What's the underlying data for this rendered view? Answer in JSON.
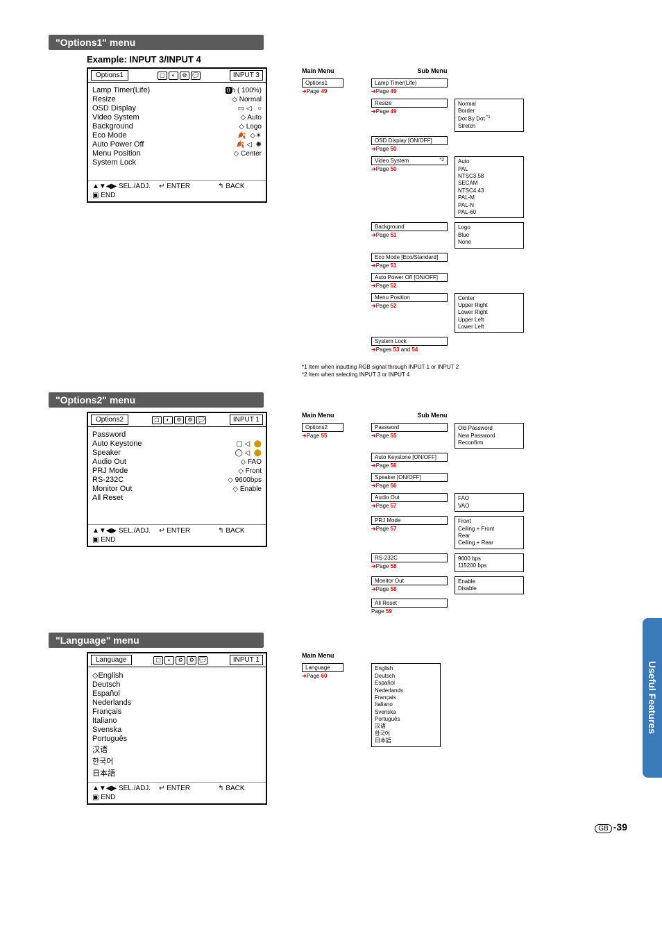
{
  "sections": {
    "options1": {
      "title": "\"Options1\" menu",
      "example": "Example: INPUT 3/INPUT 4"
    },
    "options2": {
      "title": "\"Options2\" menu"
    },
    "language": {
      "title": "\"Language\" menu"
    }
  },
  "osd1": {
    "title": "Options1",
    "input": "INPUT 3",
    "lines": {
      "lamp": "Lamp Timer(Life)",
      "lamp_val_pre": "0",
      "lamp_val_post": "h ( 100%)",
      "resize": "Resize",
      "resize_val": "◇ Normal",
      "osd": "OSD Display",
      "video": "Video System",
      "video_val": "◇ Auto",
      "bg": "Background",
      "bg_val": "◇ Logo",
      "eco": "Eco Mode",
      "auto": "Auto Power Off",
      "menu": "Menu Position",
      "menu_val": "◇ Center",
      "lock": "System Lock"
    },
    "footer": {
      "sel": "▲▼◀▶ SEL./ADJ.",
      "enter": "↵ ENTER",
      "back": "↰ BACK",
      "end": "▣ END"
    }
  },
  "osd2": {
    "title": "Options2",
    "input": "INPUT 1",
    "lines": {
      "pwd": "Password",
      "ak": "Auto Keystone",
      "spk": "Speaker",
      "audio": "Audio Out",
      "audio_val": "◇ FAO",
      "prj": "PRJ Mode",
      "prj_val": "◇ Front",
      "rs": "RS-232C",
      "rs_val": "◇ 9600bps",
      "mon": "Monitor Out",
      "mon_val": "◇ Enable",
      "reset": "All Reset"
    },
    "footer": {
      "sel": "▲▼◀▶ SEL./ADJ.",
      "enter": "↵ ENTER",
      "back": "↰ BACK",
      "end": "▣ END"
    }
  },
  "osd3": {
    "title": "Language",
    "input": "INPUT 1",
    "langs": [
      "◇English",
      "Deutsch",
      "Español",
      "Nederlands",
      "Français",
      "Italiano",
      "Svenska",
      "Português",
      "汉语",
      "한국어",
      "日本語"
    ],
    "footer": {
      "sel": "▲▼◀▶ SEL./ADJ.",
      "enter": "↵ ENTER",
      "back": "↰ BACK",
      "end": "▣ END"
    }
  },
  "tree1": {
    "header_main": "Main Menu",
    "header_sub": "Sub Menu",
    "main": {
      "label": "Options1",
      "page_prefix": "Page ",
      "page": "49"
    },
    "items": [
      {
        "label": "Lamp Timer(Life)",
        "page": "49"
      },
      {
        "label": "Resize",
        "page": "49",
        "sub": [
          "Normal",
          "Border",
          "Dot By Dot *1",
          "Stretch"
        ]
      },
      {
        "label": "OSD Display [ON/OFF]",
        "page": "50"
      },
      {
        "label": "Video System",
        "page": "50",
        "note": "*2",
        "sub": [
          "Auto",
          "PAL",
          "NTSC3.58",
          "SECAM",
          "NTSC4.43",
          "PAL-M",
          "PAL-N",
          "PAL-60"
        ]
      },
      {
        "label": "Background",
        "page": "51",
        "sub": [
          "Logo",
          "Blue",
          "None"
        ]
      },
      {
        "label": "Eco Mode [Eco/Standard]",
        "page": "51"
      },
      {
        "label": "Auto Power Off [ON/OFF]",
        "page": "52"
      },
      {
        "label": "Menu Position",
        "page": "52",
        "sub": [
          "Center",
          "Upper Right",
          "Lower Right",
          "Upper Left",
          "Lower Left"
        ]
      },
      {
        "label": "System Lock",
        "pages_text": "Pages ",
        "page": "53",
        "and": " and ",
        "page2": "54"
      }
    ],
    "footnotes": [
      "*1  Item when inputting RGB signal through INPUT 1 or INPUT 2",
      "*2  Item when selecting INPUT 3 or INPUT 4"
    ]
  },
  "tree2": {
    "header_main": "Main Menu",
    "header_sub": "Sub Menu",
    "main": {
      "label": "Options2",
      "page_prefix": "Page ",
      "page": "55"
    },
    "items": [
      {
        "label": "Password",
        "page": "55",
        "sub": [
          "Old Password",
          "New Password",
          "Reconfirm"
        ]
      },
      {
        "label": "Auto Keystone [ON/OFF]",
        "page": "56"
      },
      {
        "label": "Speaker [ON/OFF]",
        "page": "56"
      },
      {
        "label": "Audio Out",
        "page": "57",
        "sub": [
          "FAO",
          "VAO"
        ]
      },
      {
        "label": "PRJ Mode",
        "page": "57",
        "sub": [
          "Front",
          "Ceiling + Front",
          "Rear",
          "Ceiling + Rear"
        ]
      },
      {
        "label": "RS-232C",
        "page": "58",
        "sub": [
          "9600 bps",
          "115200 bps"
        ]
      },
      {
        "label": "Monitor Out",
        "page": "58",
        "sub": [
          "Enable",
          "Disable"
        ]
      },
      {
        "label": "All Reset",
        "page": "59",
        "no_arrow": true
      }
    ]
  },
  "tree3": {
    "header_main": "Main Menu",
    "main": {
      "label": "Language",
      "page_prefix": "Page ",
      "page": "60"
    },
    "sub": [
      "English",
      "Deutsch",
      "Español",
      "Nederlands",
      "Français",
      "Italiano",
      "Svenska",
      "Português",
      "汉语",
      "한국어",
      "日本語"
    ]
  },
  "sidebar": "Useful Features",
  "pagenum": {
    "gb": "GB",
    "dash": "-",
    "num": "39"
  }
}
